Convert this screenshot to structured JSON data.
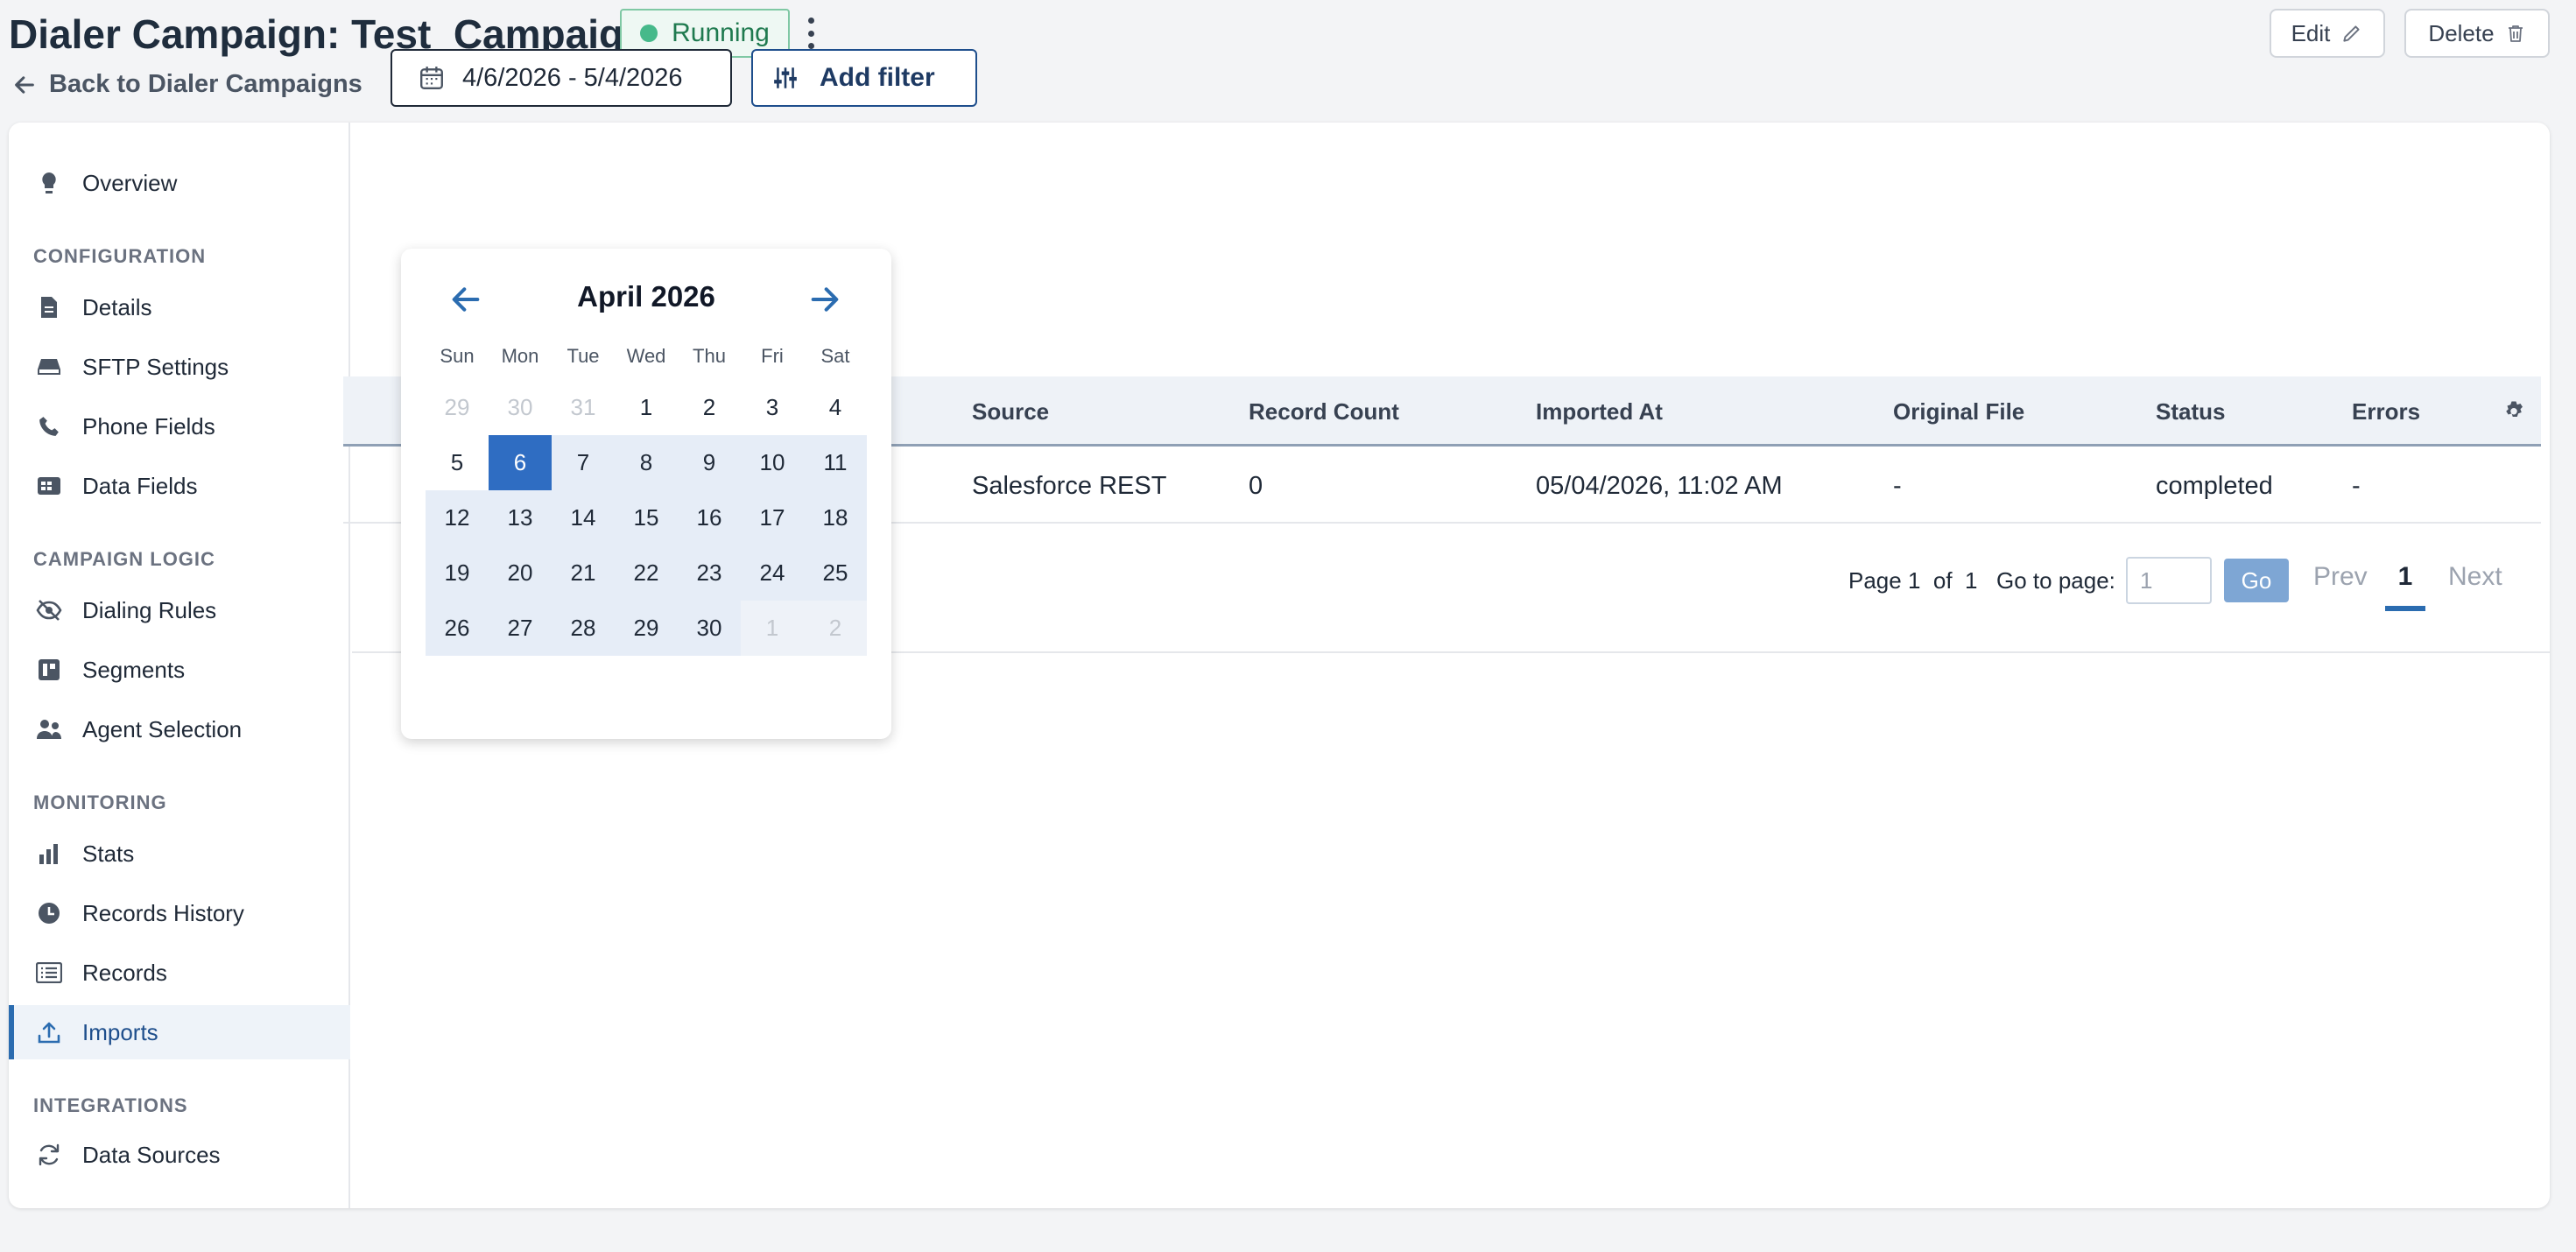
{
  "header": {
    "title": "Dialer Campaign: Test_Campaign",
    "status": "Running",
    "back_label": "Back to Dialer Campaigns",
    "edit_label": "Edit",
    "delete_label": "Delete"
  },
  "sidebar": {
    "overview": "Overview",
    "sections": {
      "configuration": "CONFIGURATION",
      "campaign_logic": "CAMPAIGN LOGIC",
      "monitoring": "MONITORING",
      "integrations": "INTEGRATIONS"
    },
    "items": {
      "details": "Details",
      "sftp": "SFTP Settings",
      "phone_fields": "Phone Fields",
      "data_fields": "Data Fields",
      "dialing_rules": "Dialing Rules",
      "segments": "Segments",
      "agent_selection": "Agent Selection",
      "stats": "Stats",
      "records_history": "Records History",
      "records": "Records",
      "imports": "Imports",
      "data_sources": "Data Sources"
    },
    "active": "Imports"
  },
  "filters": {
    "date_range": "4/6/2026 - 5/4/2026",
    "add_filter": "Add filter"
  },
  "calendar": {
    "month": "April 2026",
    "weekdays": [
      "Sun",
      "Mon",
      "Tue",
      "Wed",
      "Thu",
      "Fri",
      "Sat"
    ],
    "weeks": [
      [
        "29",
        "30",
        "31",
        "1",
        "2",
        "3",
        "4"
      ],
      [
        "5",
        "6",
        "7",
        "8",
        "9",
        "10",
        "11"
      ],
      [
        "12",
        "13",
        "14",
        "15",
        "16",
        "17",
        "18"
      ],
      [
        "19",
        "20",
        "21",
        "22",
        "23",
        "24",
        "25"
      ],
      [
        "26",
        "27",
        "28",
        "29",
        "30",
        "1",
        "2"
      ]
    ],
    "selected_day": "6"
  },
  "table": {
    "columns": [
      "Source",
      "Record Count",
      "Imported At",
      "Original File",
      "Status",
      "Errors"
    ],
    "rows": [
      [
        "Salesforce REST",
        "0",
        "05/04/2026, 11:02 AM",
        "-",
        "completed",
        "-"
      ]
    ]
  },
  "pagination": {
    "page_label": "Page",
    "current": "1",
    "of_label": "of",
    "total": "1",
    "goto_label": "Go to page:",
    "goto_value": "1",
    "go_label": "Go",
    "prev_label": "Prev",
    "next_label": "Next"
  },
  "colors": {
    "accent": "#2b6cb0",
    "running": "#46b98a"
  }
}
